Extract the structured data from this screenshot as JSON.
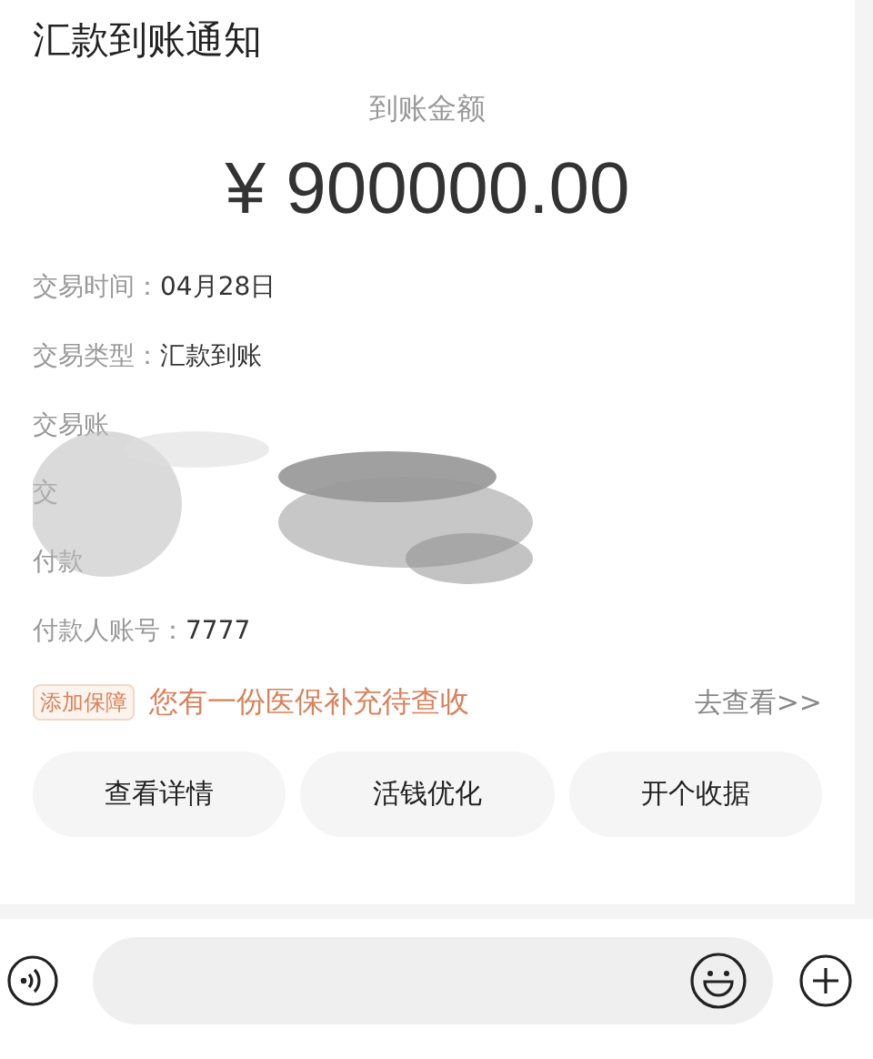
{
  "card": {
    "title": "汇款到账通知",
    "amount_label": "到账金额",
    "amount": "¥ 900000.00",
    "fields": [
      {
        "label": "交易时间：",
        "value": "04月28日"
      },
      {
        "label": "交易类型：",
        "value": "汇款到账"
      },
      {
        "label": "交易账"
      },
      {
        "label": "交"
      },
      {
        "label": "付款"
      },
      {
        "label": "付款人账号：",
        "value": "7777"
      }
    ],
    "promo": {
      "tag": "添加保障",
      "text": "您有一份医保补充待查收",
      "link": "去查看>>"
    },
    "buttons": [
      "查看详情",
      "活钱优化",
      "开个收据"
    ]
  }
}
